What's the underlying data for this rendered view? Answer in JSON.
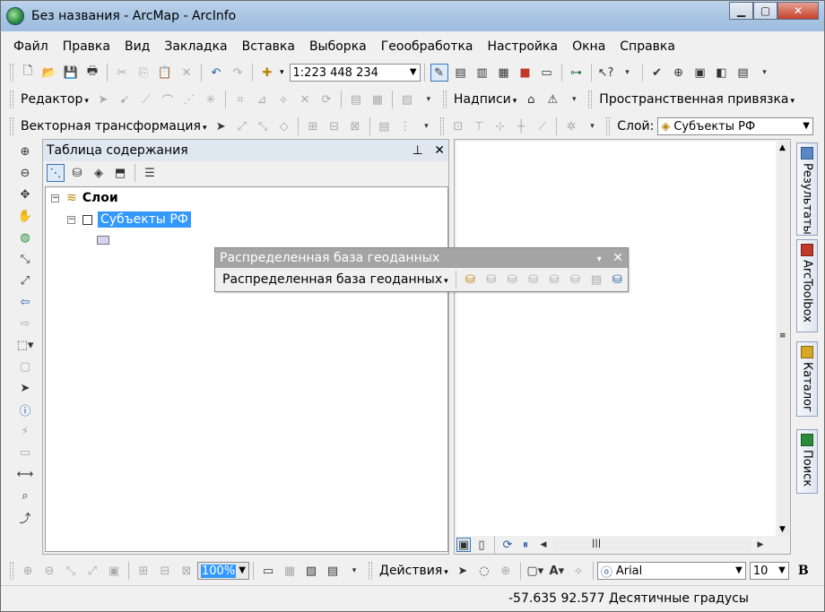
{
  "window": {
    "title": "Без названия - ArcMap - ArcInfo"
  },
  "menu": [
    "Файл",
    "Правка",
    "Вид",
    "Закладка",
    "Вставка",
    "Выборка",
    "Геообработка",
    "Настройка",
    "Окна",
    "Справка"
  ],
  "standard_toolbar": {
    "scale": "1:223 448 234"
  },
  "editor_toolbar": {
    "editor_label": "Редактор",
    "labels_label": "Надписи",
    "georef_label": "Пространственная привязка"
  },
  "spatial_adjust_toolbar": {
    "label": "Векторная трансформация",
    "layer_label": "Слой:",
    "layer_value": "Субъекты РФ"
  },
  "toc": {
    "title": "Таблица содержания",
    "pin": "ᵖ",
    "root_label": "Слои",
    "layer_label": "Субъекты РФ"
  },
  "right_tabs": [
    "Результаты",
    "ArcToolbox",
    "Каталог",
    "Поиск"
  ],
  "floating_toolbar": {
    "title": "Распределенная база геоданных",
    "dropdown_label": "Распределенная база геоданных"
  },
  "draw_toolbar": {
    "zoom_value": "100%",
    "actions_label": "Действия",
    "font_name": "Arial",
    "font_size": "10",
    "bold_label": "B"
  },
  "status": {
    "coords": "-57.635  92.577 Десятичные градусы"
  }
}
